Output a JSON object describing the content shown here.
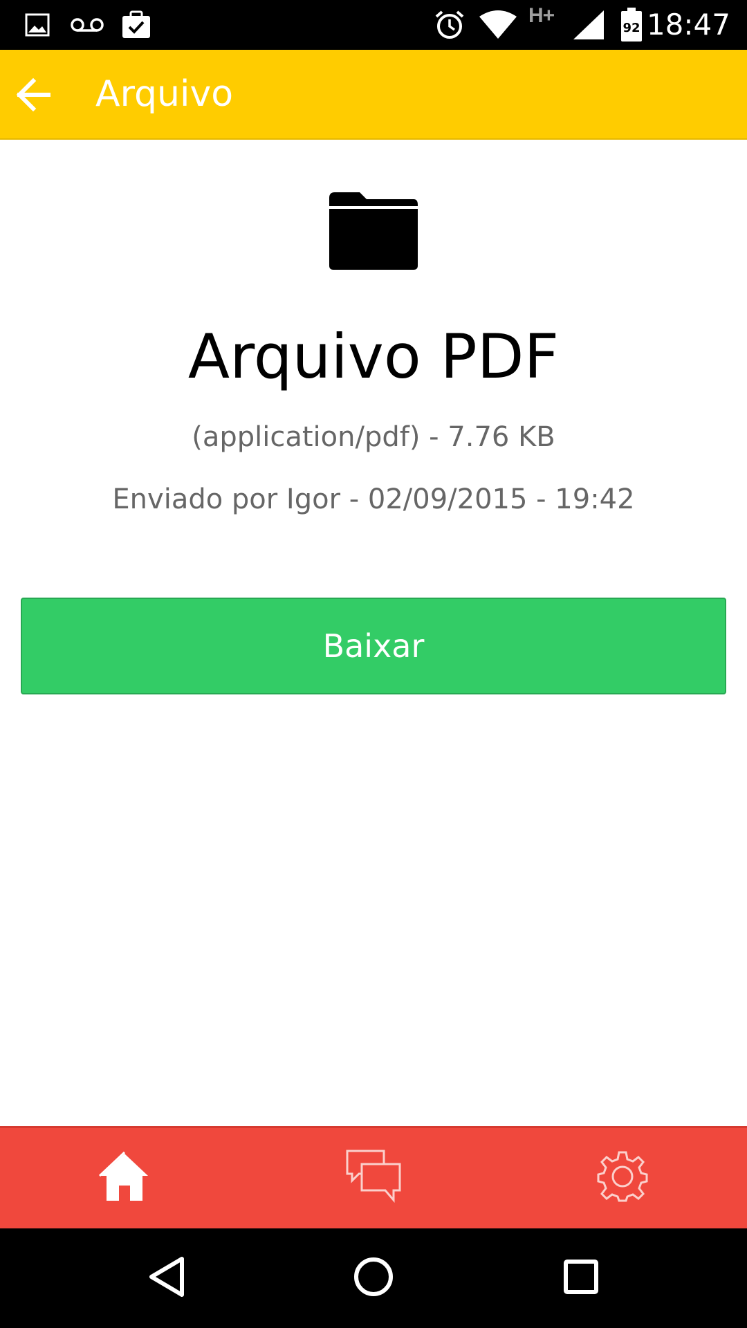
{
  "status_bar": {
    "time": "18:47",
    "network_type": "H+",
    "battery_level": "92",
    "icons": [
      "image-icon",
      "voicemail-icon",
      "clipboard-check-icon",
      "alarm-icon",
      "wifi-icon",
      "signal-icon",
      "battery-icon"
    ]
  },
  "app_bar": {
    "title": "Arquivo",
    "background_color": "#ffcc00",
    "back_icon": "arrow-left-icon"
  },
  "file": {
    "icon": "folder-icon",
    "name": "Arquivo PDF",
    "meta": "(application/pdf) - 7.76 KB",
    "sender": "Enviado por Igor - 02/09/2015 - 19:42"
  },
  "download_button": {
    "label": "Baixar",
    "color": "#33cc66"
  },
  "tab_bar": {
    "background_color": "#f0483d",
    "tabs": [
      {
        "icon": "home-icon",
        "active": true
      },
      {
        "icon": "chat-icon",
        "active": false
      },
      {
        "icon": "gear-icon",
        "active": false
      }
    ]
  },
  "nav_bar": {
    "buttons": [
      "back-triangle-icon",
      "home-circle-icon",
      "recents-square-icon"
    ]
  }
}
